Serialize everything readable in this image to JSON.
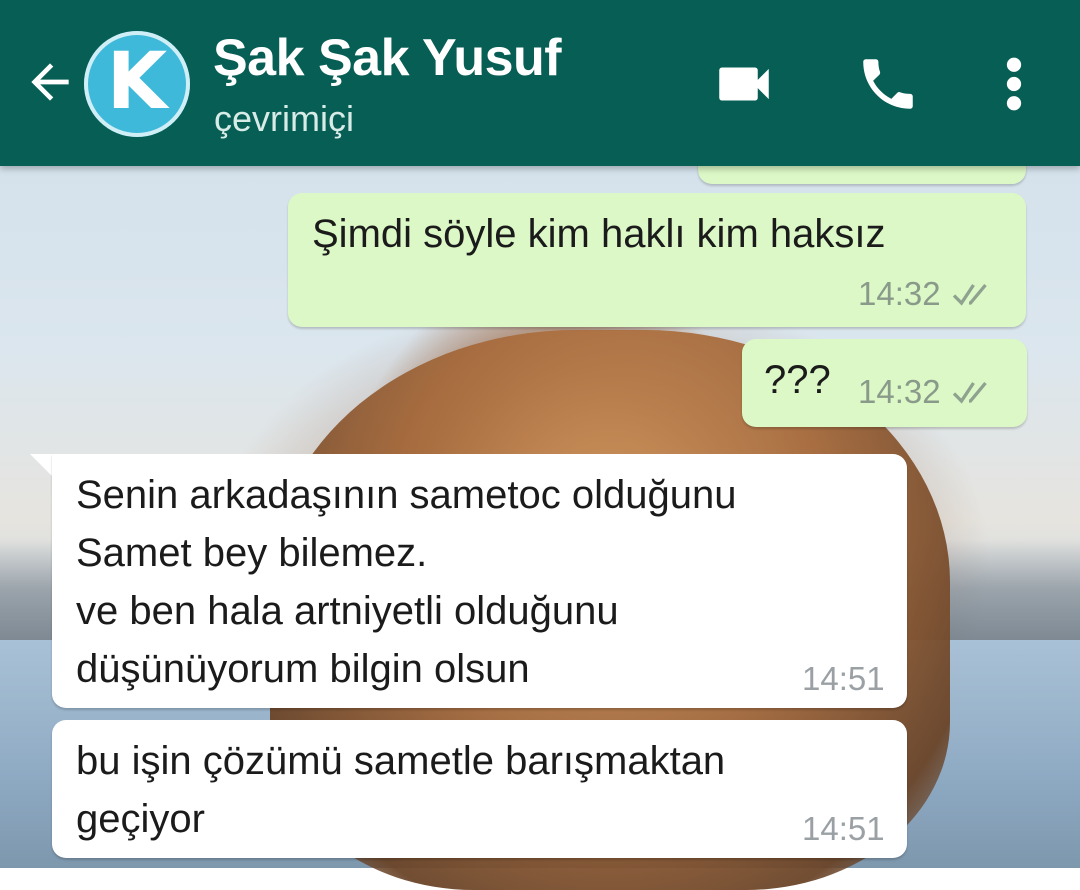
{
  "header": {
    "back_icon": "arrow-left-icon",
    "avatar_letter": "K",
    "contact_name": "Şak Şak Yusuf",
    "status": "çevrimiçi",
    "video_icon": "video-camera-icon",
    "call_icon": "phone-icon",
    "menu_icon": "more-vert-icon",
    "color": "#075e54"
  },
  "messages": [
    {
      "direction": "outgoing",
      "text": "Şimdi söyle kim haklı kim haksız",
      "time": "14:32",
      "status_icon": "double-check-icon"
    },
    {
      "direction": "outgoing",
      "text": "???",
      "time": "14:32",
      "status_icon": "double-check-icon"
    },
    {
      "direction": "incoming",
      "text": "Senin arkadaşının sametoc olduğunu\nSamet bey bilemez.\nve ben hala artniyetli olduğunu\ndüşünüyorum bilgin olsun",
      "time": "14:51"
    },
    {
      "direction": "incoming",
      "text": "bu işin çözümü sametle barışmaktan\ngeçiyor",
      "time": "14:51"
    }
  ],
  "colors": {
    "outgoing_bubble": "#dcf8c6",
    "incoming_bubble": "#ffffff"
  }
}
